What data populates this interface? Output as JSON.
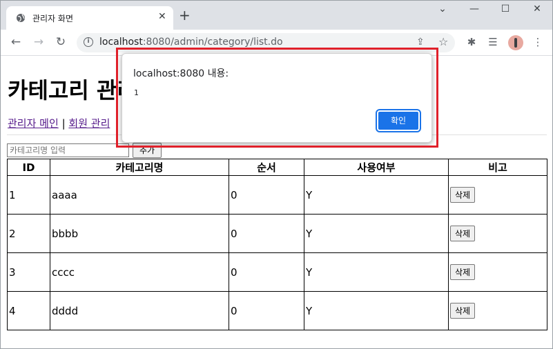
{
  "browser": {
    "tab_title": "관리자 화면",
    "tab_close": "✕",
    "new_tab": "+",
    "url_host": "localhost",
    "url_path": ":8080/admin/category/list.do",
    "window_controls": {
      "minimize": "—",
      "maximize": "☐",
      "close": "✕"
    },
    "nav": {
      "back": "←",
      "forward": "→",
      "reload": "↻"
    }
  },
  "page": {
    "heading": "카테고리 관리",
    "nav_links": [
      "관리자 메인",
      "회원 관리"
    ],
    "nav_separator": "|",
    "category_input_placeholder": "카테고리명 입력",
    "add_button": "추가",
    "table": {
      "headers": [
        "ID",
        "카테고리명",
        "순서",
        "사용여부",
        "비고"
      ],
      "rows": [
        {
          "id": "1",
          "name": "aaaa",
          "order": "0",
          "use": "Y",
          "action": "삭제"
        },
        {
          "id": "2",
          "name": "bbbb",
          "order": "0",
          "use": "Y",
          "action": "삭제"
        },
        {
          "id": "3",
          "name": "cccc",
          "order": "0",
          "use": "Y",
          "action": "삭제"
        },
        {
          "id": "4",
          "name": "dddd",
          "order": "0",
          "use": "Y",
          "action": "삭제"
        }
      ]
    }
  },
  "dialog": {
    "title": "localhost:8080 내용:",
    "message": "1",
    "ok_button": "확인"
  },
  "colors": {
    "highlight_border": "#e0202a",
    "ok_button_bg": "#1a73e8",
    "visited_link": "#551a8b"
  }
}
